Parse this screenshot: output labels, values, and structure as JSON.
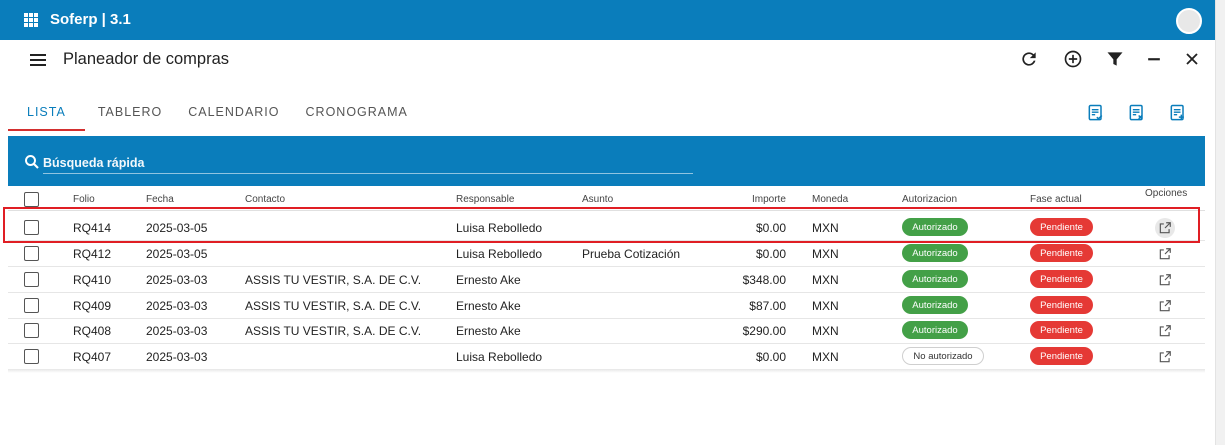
{
  "app": {
    "title": "Soferp | 3.1"
  },
  "page": {
    "title": "Planeador de compras"
  },
  "tabs": [
    {
      "label": "LISTA"
    },
    {
      "label": "TABLERO"
    },
    {
      "label": "CALENDARIO"
    },
    {
      "label": "CRONOGRAMA"
    }
  ],
  "toolbar": {
    "icons": [
      "refresh-icon",
      "add-circle-icon",
      "filter-icon",
      "minimize-icon",
      "close-icon"
    ],
    "doc_icons": [
      "document-check-icon",
      "document-remove-icon",
      "document-add-icon"
    ]
  },
  "search": {
    "placeholder": "Búsqueda rápida"
  },
  "table": {
    "headers": {
      "folio": "Folio",
      "fecha": "Fecha",
      "contacto": "Contacto",
      "responsable": "Responsable",
      "asunto": "Asunto",
      "importe": "Importe",
      "moneda": "Moneda",
      "autorizacion": "Autorizacion",
      "fase": "Fase actual",
      "opciones": "Opciones"
    },
    "rows": [
      {
        "folio": "RQ414",
        "fecha": "2025-03-05",
        "contacto": "",
        "responsable": "Luisa Rebolledo",
        "asunto": "",
        "importe": "$0.00",
        "moneda": "MXN",
        "autorizacion": "Autorizado",
        "fase": "Pendiente"
      },
      {
        "folio": "RQ412",
        "fecha": "2025-03-05",
        "contacto": "",
        "responsable": "Luisa Rebolledo",
        "asunto": "Prueba Cotización",
        "importe": "$0.00",
        "moneda": "MXN",
        "autorizacion": "Autorizado",
        "fase": "Pendiente"
      },
      {
        "folio": "RQ410",
        "fecha": "2025-03-03",
        "contacto": "ASSIS TU VESTIR, S.A. DE C.V.",
        "responsable": "Ernesto Ake",
        "asunto": "",
        "importe": "$348.00",
        "moneda": "MXN",
        "autorizacion": "Autorizado",
        "fase": "Pendiente"
      },
      {
        "folio": "RQ409",
        "fecha": "2025-03-03",
        "contacto": "ASSIS TU VESTIR, S.A. DE C.V.",
        "responsable": "Ernesto Ake",
        "asunto": "",
        "importe": "$87.00",
        "moneda": "MXN",
        "autorizacion": "Autorizado",
        "fase": "Pendiente"
      },
      {
        "folio": "RQ408",
        "fecha": "2025-03-03",
        "contacto": "ASSIS TU VESTIR, S.A. DE C.V.",
        "responsable": "Ernesto Ake",
        "asunto": "",
        "importe": "$290.00",
        "moneda": "MXN",
        "autorizacion": "Autorizado",
        "fase": "Pendiente"
      },
      {
        "folio": "RQ407",
        "fecha": "2025-03-03",
        "contacto": "",
        "responsable": "Luisa Rebolledo",
        "asunto": "",
        "importe": "$0.00",
        "moneda": "MXN",
        "autorizacion": "No autorizado",
        "fase": "Pendiente"
      }
    ]
  },
  "colors": {
    "primary": "#0a7dbb",
    "tab_indicator": "#d32f2f",
    "authorized": "#43a047",
    "pending": "#e53935",
    "highlight": "#e01e24"
  }
}
